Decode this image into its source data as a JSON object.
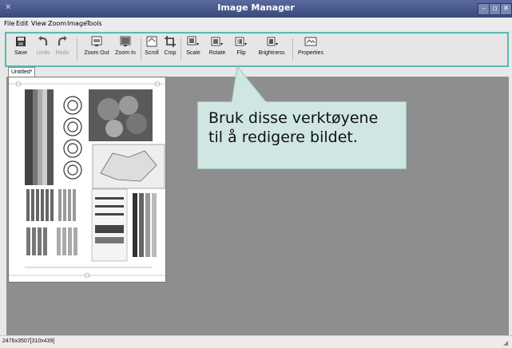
{
  "window": {
    "title": "Image Manager"
  },
  "menu": [
    {
      "label": "File"
    },
    {
      "label": "Edit"
    },
    {
      "label": "View"
    },
    {
      "label": "Zoom"
    },
    {
      "label": "Image"
    },
    {
      "label": "Tools"
    }
  ],
  "toolbar": {
    "save": "Save",
    "undo": "Undo",
    "redo": "Redo",
    "zoom_out": "Zoom Out",
    "zoom_in": "Zoom In",
    "scroll": "Scroll",
    "crop": "Crop",
    "scale": "Scale",
    "rotate": "Rotate",
    "flip": "Flip",
    "brightness": "Brightness",
    "properties": "Properties"
  },
  "tabs": [
    {
      "label": "Untitled*"
    }
  ],
  "callout": {
    "text": "Bruk disse verktøyene\ntil å redigere bildet."
  },
  "status": {
    "text": "2476x3507[310x439]"
  },
  "colors": {
    "titlebar": "#3a4878",
    "highlight": "#5cb8b0",
    "callout_bg": "#cfe6e3",
    "canvas": "#8e8e8e"
  }
}
